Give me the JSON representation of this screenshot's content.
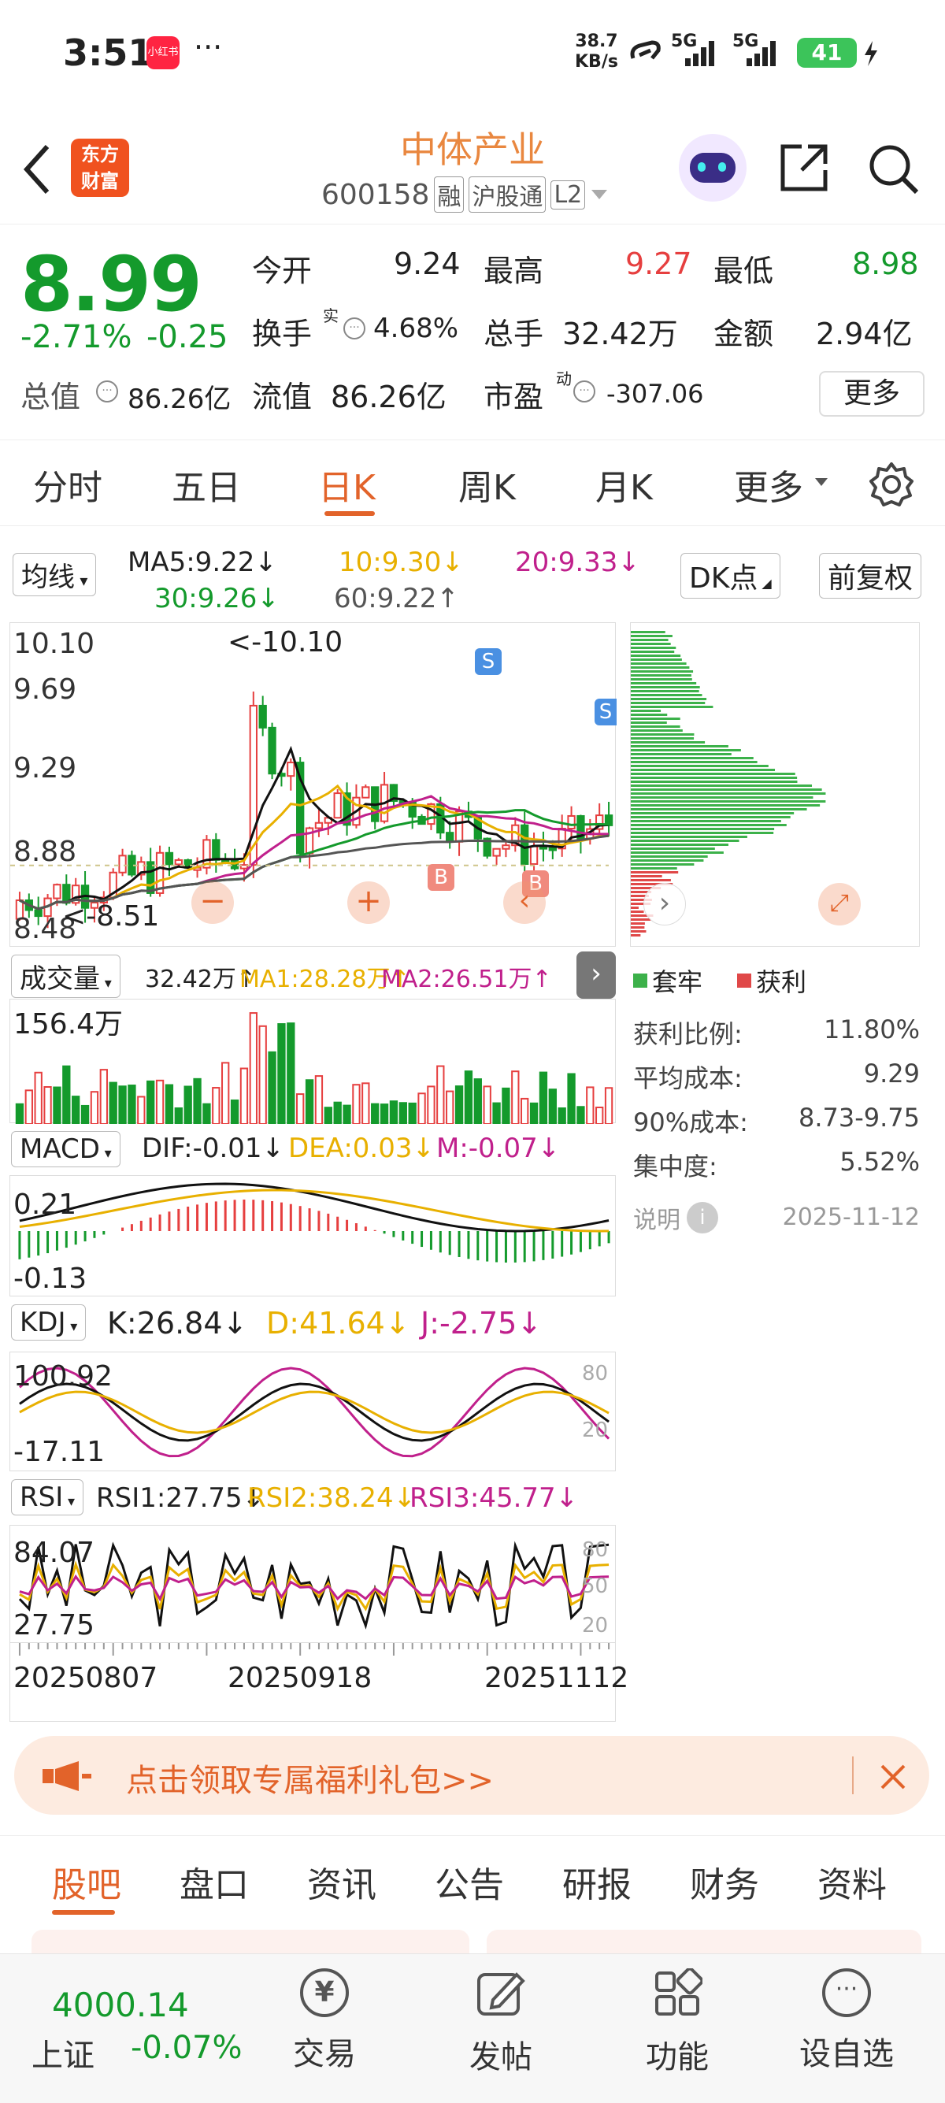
{
  "status_bar": {
    "time": "3:51",
    "app_badge": "小红书",
    "more": "···",
    "net_speed_top": "38.7",
    "net_speed_bottom": "KB/s",
    "signal1": "5G",
    "signal2": "5G",
    "battery": "41"
  },
  "header": {
    "logo_line1": "东方",
    "logo_line2": "财富",
    "stock_name": "中体产业",
    "stock_code": "600158",
    "tag_margin": "融",
    "tag_connect": "沪股通",
    "tag_level": "L2"
  },
  "quote": {
    "price": "8.99",
    "change_pct": "-2.71%",
    "change": "-0.25",
    "open_label": "今开",
    "open": "9.24",
    "high_label": "最高",
    "high": "9.27",
    "low_label": "最低",
    "low": "8.98",
    "turnover_label": "换手",
    "turnover_sup": "实",
    "turnover": "4.68%",
    "volume_label": "总手",
    "volume": "32.42万",
    "amount_label": "金额",
    "amount": "2.94亿",
    "mktcap_label": "总值",
    "mktcap": "86.26亿",
    "float_label": "流值",
    "float": "86.26亿",
    "pe_label": "市盈",
    "pe_sup": "动",
    "pe": "-307.06",
    "more_button": "更多"
  },
  "period_tabs": [
    "分时",
    "五日",
    "日K",
    "周K",
    "月K",
    "更多"
  ],
  "active_tab": "日K",
  "ma_bar": {
    "selector": "均线",
    "ma5": "MA5:9.22↓",
    "ma10": "10:9.30↓",
    "ma20": "20:9.33↓",
    "ma30": "30:9.26↓",
    "ma60": "60:9.22↑",
    "dk_button": "DK点",
    "adj_button": "前复权"
  },
  "kline": {
    "y_labels": [
      "10.10",
      "9.69",
      "9.29",
      "8.88",
      "8.48"
    ],
    "max_label": "<-10.10",
    "min_label": "<-8.51",
    "sell_marker": "S",
    "buy_marker": "B"
  },
  "volume_panel": {
    "selector": "成交量",
    "vol": "32.42万↑",
    "ma1": "MA1:28.28万↑",
    "ma2": "MA2:26.51万↑",
    "y_label": "156.4万"
  },
  "macd_panel": {
    "selector": "MACD",
    "dif": "DIF:-0.01↓",
    "dea": "DEA:0.03↓",
    "m": "M:-0.07↓",
    "y_top": "0.21",
    "y_bottom": "-0.13"
  },
  "kdj_panel": {
    "selector": "KDJ",
    "k": "K:26.84↓",
    "d": "D:41.64↓",
    "j": "J:-2.75↓",
    "y_top": "100.92",
    "y_bottom": "-17.11",
    "ref80": "80",
    "ref20": "20"
  },
  "rsi_panel": {
    "selector": "RSI",
    "rsi1": "RSI1:27.75↓",
    "rsi2": "RSI2:38.24↓",
    "rsi3": "RSI3:45.77↓",
    "y_top": "84.07",
    "y_bottom": "27.75",
    "ref80": "80",
    "ref50": "50",
    "ref20": "20"
  },
  "x_dates": [
    "20250807",
    "20250918",
    "20251112"
  ],
  "chip": {
    "legend_trapped": "套牢",
    "legend_profit": "获利",
    "rows": [
      {
        "label": "获利比例:",
        "value": "11.80%"
      },
      {
        "label": "平均成本:",
        "value": "9.29"
      },
      {
        "label": "90%成本:",
        "value": "8.73-9.75"
      },
      {
        "label": "集中度:",
        "value": "5.52%"
      }
    ],
    "note_label": "说明",
    "note_icon": "i",
    "date": "2025-11-12"
  },
  "promo": {
    "text": "点击领取专属福利礼包>>"
  },
  "section_tabs": [
    "股吧",
    "盘口",
    "资讯",
    "公告",
    "研报",
    "财务",
    "资料"
  ],
  "bottom_nav": {
    "index_value": "4000.14",
    "index_name": "上证",
    "index_change": "-0.07%",
    "trade": "交易",
    "post": "发帖",
    "features": "功能",
    "watchlist": "设自选",
    "trade_icon_glyph": "¥"
  },
  "colors": {
    "up": "#e63f3f",
    "down": "#149a2c",
    "accent": "#e2632a",
    "ma10": "#e8b000",
    "ma20": "#c0208c",
    "ma30": "#149a2c",
    "ma60": "#555555"
  }
}
